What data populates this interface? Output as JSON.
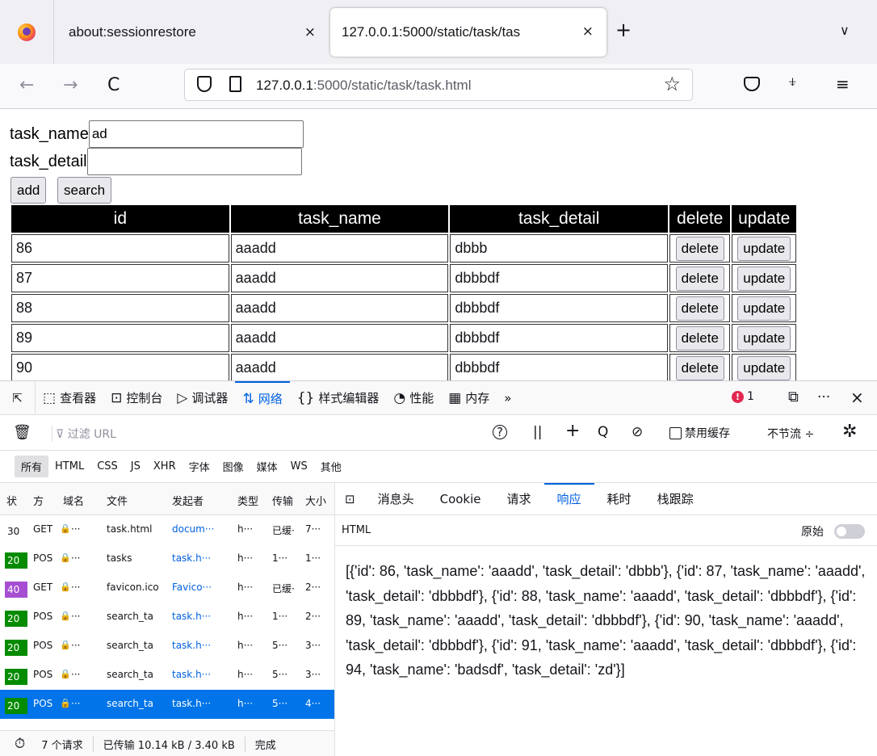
{
  "browser": {
    "tabs": [
      {
        "title": "about:sessionrestore",
        "close": "×"
      },
      {
        "title_main": "127.0.0.1:5000/static/task/tas",
        "close": "×"
      }
    ],
    "new_tab": "+",
    "tab_list": "∨",
    "nav": {
      "back": "←",
      "forward": "→",
      "reload": "C",
      "star": "☆",
      "extensions": "⍖",
      "menu": "≡"
    },
    "url_host": "127.0.0.1",
    "url_rest": ":5000/static/task/task.html"
  },
  "page": {
    "task_name_label": "task_name",
    "task_name_value": "ad",
    "task_detail_label": "task_detail",
    "task_detail_value": "",
    "add_label": "add",
    "search_label": "search",
    "table": {
      "headers": [
        "id",
        "task_name",
        "task_detail",
        "delete",
        "update"
      ],
      "rows": [
        {
          "id": "86",
          "name": "aaadd",
          "detail": "dbbb"
        },
        {
          "id": "87",
          "name": "aaadd",
          "detail": "dbbbdf"
        },
        {
          "id": "88",
          "name": "aaadd",
          "detail": "dbbbdf"
        },
        {
          "id": "89",
          "name": "aaadd",
          "detail": "dbbbdf"
        },
        {
          "id": "90",
          "name": "aaadd",
          "detail": "dbbbdf"
        }
      ],
      "delete_label": "delete",
      "update_label": "update"
    }
  },
  "devtools": {
    "tabs": [
      {
        "icon": "⬚",
        "label": "查看器"
      },
      {
        "icon": "⊡",
        "label": "控制台"
      },
      {
        "icon": "▷",
        "label": "调试器"
      },
      {
        "icon": "⇅",
        "label": "网络"
      },
      {
        "icon": "{}",
        "label": "样式编辑器"
      },
      {
        "icon": "◔",
        "label": "性能"
      },
      {
        "icon": "▦",
        "label": "内存"
      }
    ],
    "more_tabs": "»",
    "error_count": "1",
    "error_icon": "!",
    "dock": "⧉",
    "more": "···",
    "close": "×",
    "network": {
      "filter_placeholder": "过滤 URL",
      "filter_icon": "⊽",
      "trash": "🗑",
      "help": "?",
      "pause": "||",
      "plus": "+",
      "search": "Q",
      "block": "⊘",
      "disable_cache": "禁用缓存",
      "throttle": "不节流 ÷",
      "settings": "✲",
      "type_filters": [
        "所有",
        "HTML",
        "CSS",
        "JS",
        "XHR",
        "字体",
        "图像",
        "媒体",
        "WS",
        "其他"
      ],
      "columns": [
        "状",
        "方",
        "域名",
        "文件",
        "发起者",
        "类型",
        "传输",
        "大小"
      ],
      "requests": [
        {
          "status": "30",
          "method": "GET",
          "domain": "···",
          "file": "task.html",
          "initiator": "docum···",
          "type": "h···",
          "transferred": "已缓·",
          "size": "7···",
          "class": "status-3"
        },
        {
          "status": "20",
          "method": "POS",
          "domain": "···",
          "file": "tasks",
          "initiator": "task.h···",
          "type": "h···",
          "transferred": "1···",
          "size": "1···",
          "class": "status-2"
        },
        {
          "status": "40",
          "method": "GET",
          "domain": "···",
          "file": "favicon.ico",
          "initiator": "Favico···",
          "type": "h···",
          "transferred": "已缓·",
          "size": "2···",
          "class": "status-4"
        },
        {
          "status": "20",
          "method": "POS",
          "domain": "···",
          "file": "search_ta",
          "initiator": "task.h···",
          "type": "h···",
          "transferred": "1···",
          "size": "2···",
          "class": "status-2"
        },
        {
          "status": "20",
          "method": "POS",
          "domain": "···",
          "file": "search_ta",
          "initiator": "task.h···",
          "type": "h···",
          "transferred": "5···",
          "size": "3···",
          "class": "status-2"
        },
        {
          "status": "20",
          "method": "POS",
          "domain": "···",
          "file": "search_ta",
          "initiator": "task.h···",
          "type": "h···",
          "transferred": "5···",
          "size": "3···",
          "class": "status-2"
        },
        {
          "status": "20",
          "method": "POS",
          "domain": "···",
          "file": "search_ta",
          "initiator": "task.h···",
          "type": "h···",
          "transferred": "5···",
          "size": "4···",
          "class": "status-2"
        }
      ],
      "resp_tabs": [
        "消息头",
        "Cookie",
        "请求",
        "响应",
        "耗时",
        "栈跟踪"
      ],
      "resp_tab_active": "响应",
      "resp_toggle": "⊡",
      "resp_type": "HTML",
      "raw_label": "原始",
      "resp_body": "[{'id': 86, 'task_name': 'aaadd', 'task_detail': 'dbbb'}, {'id': 87, 'task_name': 'aaadd', 'task_detail': 'dbbbdf'}, {'id': 88, 'task_name': 'aaadd', 'task_detail': 'dbbbdf'}, {'id': 89, 'task_name': 'aaadd', 'task_detail': 'dbbbdf'}, {'id': 90, 'task_name': 'aaadd', 'task_detail': 'dbbbdf'}, {'id': 91, 'task_name': 'aaadd', 'task_detail': 'dbbbdf'}, {'id': 94, 'task_name': 'badsdf', 'task_detail': 'zd'}]",
      "status_bar": {
        "timer": "⏱",
        "requests": "7 个请求",
        "transferred": "已传输 10.14 kB / 3.40 kB",
        "finished": "完成"
      }
    }
  },
  "colors": {
    "accent": "#0060df",
    "status_ok": "#058b00",
    "status_client_error": "#a64ed1",
    "selected_row": "#0074e8"
  }
}
